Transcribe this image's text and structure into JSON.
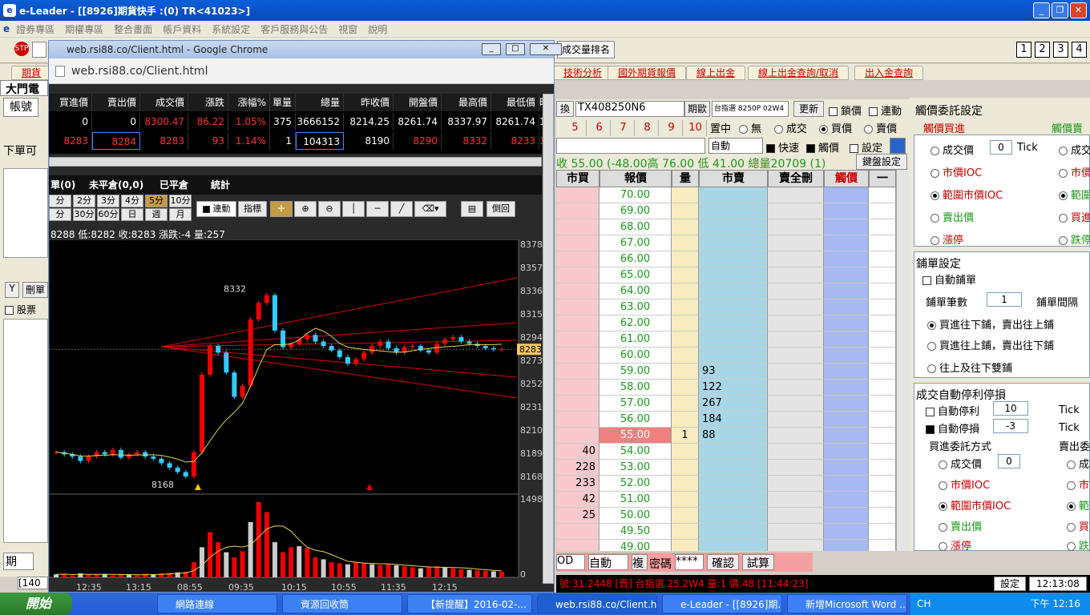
{
  "app": {
    "title": "e-Leader - [[8926]期貨快手 :(0) TR<41023>]"
  },
  "menu": [
    "證券專區",
    "期權專區",
    "整合畫面",
    "帳戶資料",
    "系統設定",
    "客戶服務與公告",
    "視窗",
    "說明"
  ],
  "toolbar": {
    "rank_button": "成交量排名",
    "num_buttons": [
      "1",
      "2",
      "3",
      "4"
    ]
  },
  "tabs": [
    "期貨",
    "技術分析",
    "國外期貨報價",
    "線上出金",
    "線上出金查詢/取消",
    "出入金查詢"
  ],
  "left": {
    "dmd": "大門電",
    "account": "帳號",
    "order_label": "下單可",
    "y": "Y",
    "del": "刪單",
    "stock": "股票",
    "period": "期"
  },
  "chrome": {
    "title": "web.rsi88.co/Client.html - Google Chrome",
    "url": "web.rsi88.co/Client.html"
  },
  "quote": {
    "headers": [
      "買進價",
      "賣出價",
      "成交價",
      "漲跌",
      "漲幅%",
      "單量",
      "總量",
      "昨收價",
      "開盤價",
      "最高價",
      "最低價",
      "時"
    ],
    "rows": [
      [
        "0",
        "0",
        "8300.47",
        "86.22",
        "1.05%",
        "375",
        "3666152",
        "8214.25",
        "8261.74",
        "8337.97",
        "8261.74",
        "1"
      ],
      [
        "8283",
        "8284",
        "8283",
        "93",
        "1.14%",
        "1",
        "104313",
        "8190",
        "8290",
        "8332",
        "8233",
        "1:"
      ]
    ]
  },
  "chart_tabs": {
    "t1": "單(0)",
    "t2": "未平倉(0,0)",
    "t3": "已平倉",
    "t4": "統計"
  },
  "periods": [
    "分",
    "2分",
    "3分",
    "4分",
    "5分",
    "10分",
    "分",
    "30分",
    "60分",
    "日",
    "週",
    "月"
  ],
  "chart_tools": {
    "link": "連動",
    "indicator": "指標",
    "reverse": "倒回"
  },
  "chart_info": "8288 低:8282 收:8283 漲跌:-4 量:257",
  "chart_data": {
    "type": "candlestick",
    "y_ticks": [
      "8378",
      "8357",
      "8336",
      "8315",
      "8294",
      "8273",
      "8252",
      "8231",
      "8210",
      "8189",
      "8168"
    ],
    "current": "8283",
    "high_label": "8332",
    "low_label": "8168",
    "x_ticks": [
      "12:35",
      "13:15",
      "08:55",
      "09:35",
      "10:15",
      "10:55",
      "11:35",
      "12:15"
    ],
    "volume_axis": [
      "1498",
      "0"
    ],
    "closes": [
      8190,
      8188,
      8186,
      8182,
      8186,
      8190,
      8188,
      8192,
      8185,
      8188,
      8190,
      8186,
      8184,
      8180,
      8176,
      8172,
      8168,
      8190,
      8260,
      8286,
      8280,
      8262,
      8240,
      8250,
      8310,
      8325,
      8332,
      8300,
      8285,
      8288,
      8292,
      8296,
      8290,
      8286,
      8282,
      8276,
      8270,
      8274,
      8280,
      8286,
      8290,
      8284,
      8280,
      8285,
      8286,
      8282,
      8280,
      8288,
      8292,
      8294,
      8290,
      8288,
      8286,
      8284,
      8283,
      8283
    ],
    "volumes": [
      60,
      70,
      40,
      80,
      50,
      60,
      70,
      40,
      60,
      50,
      40,
      70,
      60,
      80,
      90,
      100,
      110,
      300,
      600,
      900,
      700,
      500,
      400,
      520,
      1100,
      1498,
      1300,
      700,
      500,
      600,
      620,
      580,
      400,
      360,
      300,
      280,
      260,
      300,
      280,
      260,
      240,
      260,
      240,
      220,
      200,
      180,
      200,
      220,
      200,
      180,
      160,
      150,
      140,
      130,
      120,
      110
    ]
  },
  "orderbook": {
    "contract": "TX408250N6",
    "contract_tag": "換",
    "mode": "期歐",
    "chip": "台指選 8250P 02W4",
    "update": "更新",
    "lock": "鎖價",
    "link": "連動",
    "qty_buttons": [
      "5",
      "6",
      "7",
      "8",
      "9",
      "10"
    ],
    "center": "置中",
    "none": "無",
    "trade": "成交",
    "buy": "買價",
    "sell": "賣價",
    "auto": "自動",
    "fast": "快速",
    "trigger": "觸價",
    "setting": "設定",
    "info": "收 55.00 (-48.00高 76.00 低 41.00 總量20709 (1)",
    "keyboard": "鍵盤設定",
    "headers": [
      "市買",
      "報價",
      "量",
      "市賣",
      "賣全刪",
      "觸價",
      "一"
    ],
    "rows": [
      {
        "bid": "",
        "price": "70.00",
        "ask": ""
      },
      {
        "bid": "",
        "price": "69.00",
        "ask": ""
      },
      {
        "bid": "",
        "price": "68.00",
        "ask": ""
      },
      {
        "bid": "",
        "price": "67.00",
        "ask": ""
      },
      {
        "bid": "",
        "price": "66.00",
        "ask": ""
      },
      {
        "bid": "",
        "price": "65.00",
        "ask": ""
      },
      {
        "bid": "",
        "price": "64.00",
        "ask": ""
      },
      {
        "bid": "",
        "price": "63.00",
        "ask": ""
      },
      {
        "bid": "",
        "price": "62.00",
        "ask": ""
      },
      {
        "bid": "",
        "price": "61.00",
        "ask": ""
      },
      {
        "bid": "",
        "price": "60.00",
        "ask": ""
      },
      {
        "bid": "",
        "price": "59.00",
        "ask": "93"
      },
      {
        "bid": "",
        "price": "58.00",
        "ask": "122"
      },
      {
        "bid": "",
        "price": "57.00",
        "ask": "267"
      },
      {
        "bid": "",
        "price": "56.00",
        "ask": "184"
      },
      {
        "bid": "",
        "price": "55.00",
        "ask": "88",
        "vol": "1",
        "last": true
      },
      {
        "bid": "40",
        "price": "54.00",
        "ask": ""
      },
      {
        "bid": "228",
        "price": "53.00",
        "ask": ""
      },
      {
        "bid": "233",
        "price": "52.00",
        "ask": ""
      },
      {
        "bid": "42",
        "price": "51.00",
        "ask": ""
      },
      {
        "bid": "25",
        "price": "50.00",
        "ask": ""
      },
      {
        "bid": "",
        "price": "49.50",
        "ask": ""
      },
      {
        "bid": "",
        "price": "49.00",
        "ask": ""
      }
    ],
    "bottom": {
      "od": "OD",
      "auto": "自動",
      "dup": "複",
      "pw": "密碼",
      "mask": "****",
      "confirm": "確認",
      "calc": "試算"
    }
  },
  "right": {
    "title": "觸價委託設定",
    "buy_label": "觸價買進",
    "sell_label": "觸價賣",
    "opts": [
      "成交價",
      "市價IOC",
      "範圍市價IOC",
      "賣出價",
      "漲停"
    ],
    "opts_r": [
      "成交",
      "市價",
      "範圍",
      "買進",
      "跌停"
    ],
    "tick": "Tick",
    "zero": "0",
    "lay": "鋪單設定",
    "auto_lay": "自動鋪單",
    "lay_count": "鋪單筆數",
    "lay_count_val": "1",
    "lay_gap": "鋪單間隔",
    "lay_opts": [
      "買進往下鋪，賣出往上鋪",
      "買進往上鋪，賣出往下鋪",
      "往上及往下雙鋪"
    ],
    "stop": "成交自動停利停損",
    "take": "自動停利",
    "take_val": "10",
    "loss": "自動停損",
    "loss_val": "-3",
    "buy_way": "買進委託方式",
    "sell_way": "賣出委",
    "opts2": [
      "成交價",
      "市價IOC",
      "範圍市價IOC",
      "賣出價",
      "漲停"
    ],
    "opts2_r": [
      "成",
      "市",
      "範",
      "買",
      "跌"
    ]
  },
  "status": {
    "scroll": "號:31 2448 [賣] 台指選 25 2W4 量:1 價:48 [11:44:23]",
    "setting": "設定",
    "time": "12:13:08"
  },
  "left_bottom": {
    "code": "[140"
  },
  "taskbar": {
    "start": "開始",
    "items": [
      "網路連線",
      "資源回收筒",
      "【新提醒】2016-02-...",
      "web.rsi88.co/Client.ht...",
      "e-Leader - [[8926]期...",
      "新增Microsoft Word ..."
    ],
    "lang": "CH",
    "clock": "下午 12:16"
  }
}
